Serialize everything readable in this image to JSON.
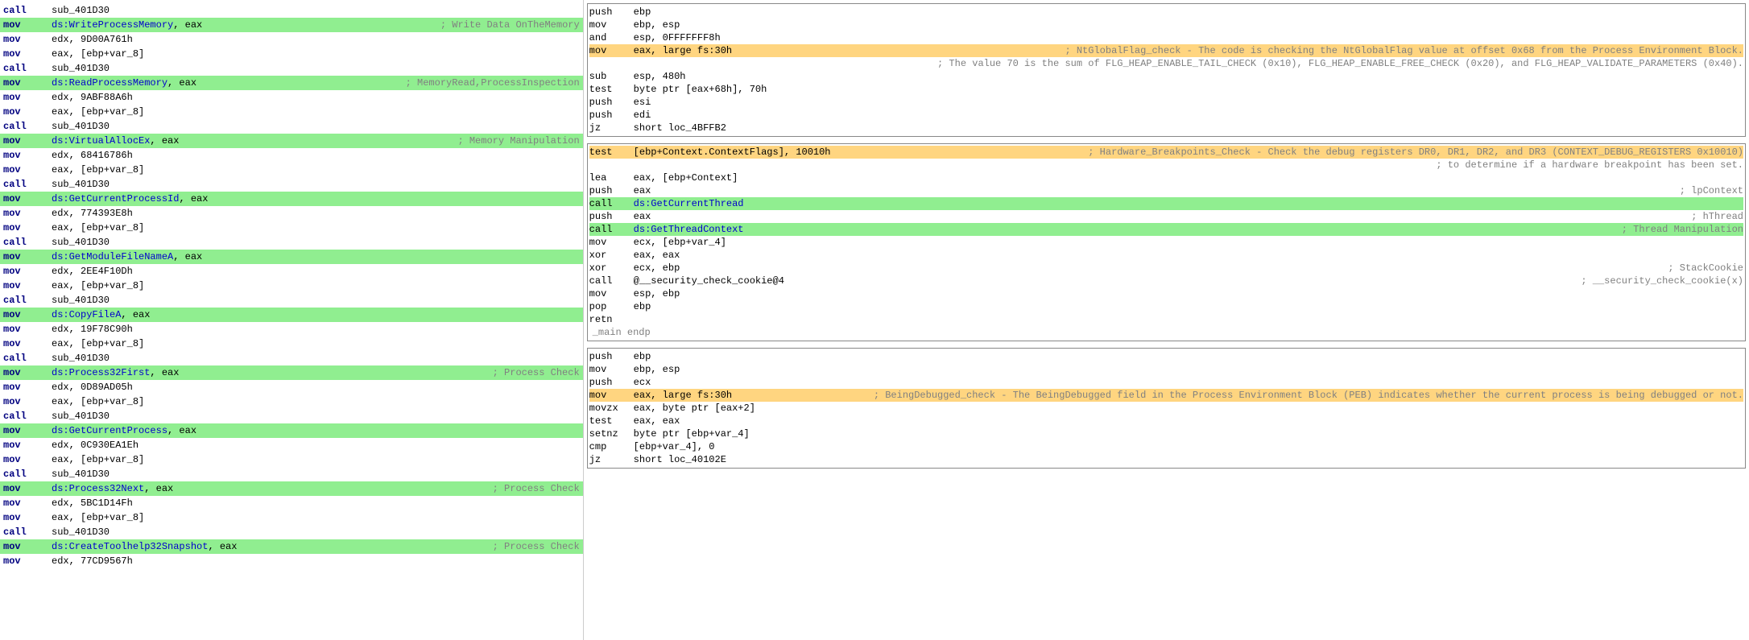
{
  "left_panel": {
    "lines": [
      {
        "type": "normal",
        "mnemonic": "call",
        "operand": "sub_401D30",
        "comment": ""
      },
      {
        "type": "green",
        "mnemonic": "mov",
        "operand": "ds:WriteProcessMemory, eax",
        "comment": "; Write Data OnTheMemory"
      },
      {
        "type": "normal",
        "mnemonic": "mov",
        "operand": "edx, 9D00A761h",
        "comment": ""
      },
      {
        "type": "normal",
        "mnemonic": "mov",
        "operand": "eax, [ebp+var_8]",
        "comment": ""
      },
      {
        "type": "normal",
        "mnemonic": "call",
        "operand": "sub_401D30",
        "comment": ""
      },
      {
        "type": "green",
        "mnemonic": "mov",
        "operand": "ds:ReadProcessMemory, eax",
        "comment": "; MemoryRead,ProcessInspection"
      },
      {
        "type": "normal",
        "mnemonic": "mov",
        "operand": "edx, 9ABF88A6h",
        "comment": ""
      },
      {
        "type": "normal",
        "mnemonic": "mov",
        "operand": "eax, [ebp+var_8]",
        "comment": ""
      },
      {
        "type": "normal",
        "mnemonic": "call",
        "operand": "sub_401D30",
        "comment": ""
      },
      {
        "type": "green",
        "mnemonic": "mov",
        "operand": "ds:VirtualAllocEx, eax",
        "comment": "; Memory Manipulation"
      },
      {
        "type": "normal",
        "mnemonic": "mov",
        "operand": "edx, 68416786h",
        "comment": ""
      },
      {
        "type": "normal",
        "mnemonic": "mov",
        "operand": "eax, [ebp+var_8]",
        "comment": ""
      },
      {
        "type": "normal",
        "mnemonic": "call",
        "operand": "sub_401D30",
        "comment": ""
      },
      {
        "type": "green",
        "mnemonic": "mov",
        "operand": "ds:GetCurrentProcessId, eax",
        "comment": ""
      },
      {
        "type": "normal",
        "mnemonic": "mov",
        "operand": "edx, 774393E8h",
        "comment": ""
      },
      {
        "type": "normal",
        "mnemonic": "mov",
        "operand": "eax, [ebp+var_8]",
        "comment": ""
      },
      {
        "type": "normal",
        "mnemonic": "call",
        "operand": "sub_401D30",
        "comment": ""
      },
      {
        "type": "green",
        "mnemonic": "mov",
        "operand": "ds:GetModuleFileNameA, eax",
        "comment": ""
      },
      {
        "type": "normal",
        "mnemonic": "mov",
        "operand": "edx, 2EE4F10Dh",
        "comment": ""
      },
      {
        "type": "normal",
        "mnemonic": "mov",
        "operand": "eax, [ebp+var_8]",
        "comment": ""
      },
      {
        "type": "normal",
        "mnemonic": "call",
        "operand": "sub_401D30",
        "comment": ""
      },
      {
        "type": "green",
        "mnemonic": "mov",
        "operand": "ds:CopyFileA, eax",
        "comment": ""
      },
      {
        "type": "normal",
        "mnemonic": "mov",
        "operand": "edx, 19F78C90h",
        "comment": ""
      },
      {
        "type": "normal",
        "mnemonic": "mov",
        "operand": "eax, [ebp+var_8]",
        "comment": ""
      },
      {
        "type": "normal",
        "mnemonic": "call",
        "operand": "sub_401D30",
        "comment": ""
      },
      {
        "type": "green",
        "mnemonic": "mov",
        "operand": "ds:Process32First, eax",
        "comment": "; Process Check"
      },
      {
        "type": "normal",
        "mnemonic": "mov",
        "operand": "edx, 0D89AD05h",
        "comment": ""
      },
      {
        "type": "normal",
        "mnemonic": "mov",
        "operand": "eax, [ebp+var_8]",
        "comment": ""
      },
      {
        "type": "normal",
        "mnemonic": "call",
        "operand": "sub_401D30",
        "comment": ""
      },
      {
        "type": "green",
        "mnemonic": "mov",
        "operand": "ds:GetCurrentProcess, eax",
        "comment": ""
      },
      {
        "type": "normal",
        "mnemonic": "mov",
        "operand": "edx, 0C930EA1Eh",
        "comment": ""
      },
      {
        "type": "normal",
        "mnemonic": "mov",
        "operand": "eax, [ebp+var_8]",
        "comment": ""
      },
      {
        "type": "normal",
        "mnemonic": "call",
        "operand": "sub_401D30",
        "comment": ""
      },
      {
        "type": "green",
        "mnemonic": "mov",
        "operand": "ds:Process32Next, eax",
        "comment": "; Process Check"
      },
      {
        "type": "normal",
        "mnemonic": "mov",
        "operand": "edx, 5BC1D14Fh",
        "comment": ""
      },
      {
        "type": "normal",
        "mnemonic": "mov",
        "operand": "eax, [ebp+var_8]",
        "comment": ""
      },
      {
        "type": "normal",
        "mnemonic": "call",
        "operand": "sub_401D30",
        "comment": ""
      },
      {
        "type": "green",
        "mnemonic": "mov",
        "operand": "ds:CreateToolhelp32Snapshot, eax",
        "comment": "; Process Check"
      },
      {
        "type": "normal",
        "mnemonic": "mov",
        "operand": "edx, 77CD9567h",
        "comment": ""
      }
    ]
  },
  "top_right": {
    "lines": [
      {
        "type": "normal",
        "mnemonic": "push",
        "operand": "ebp",
        "comment": ""
      },
      {
        "type": "normal",
        "mnemonic": "mov",
        "operand": "ebp, esp",
        "comment": ""
      },
      {
        "type": "normal",
        "mnemonic": "and",
        "operand": "esp, 0FFFFFFF8h",
        "comment": ""
      },
      {
        "type": "orange",
        "mnemonic": "mov",
        "operand": "eax, large fs:30h",
        "comment": "; NtGlobalFlag_check - The code is checking the NtGlobalFlag value at offset 0x68 from the Process Environment Block."
      },
      {
        "type": "normal",
        "mnemonic": "",
        "operand": "",
        "comment": "; The value 70 is the sum of FLG_HEAP_ENABLE_TAIL_CHECK (0x10), FLG_HEAP_ENABLE_FREE_CHECK (0x20), and FLG_HEAP_VALIDATE_PARAMETERS (0x40)."
      },
      {
        "type": "normal",
        "mnemonic": "sub",
        "operand": "esp, 480h",
        "comment": ""
      },
      {
        "type": "normal",
        "mnemonic": "test",
        "operand": "byte ptr [eax+68h], 70h",
        "comment": ""
      },
      {
        "type": "normal",
        "mnemonic": "push",
        "operand": "esi",
        "comment": ""
      },
      {
        "type": "normal",
        "mnemonic": "push",
        "operand": "edi",
        "comment": ""
      },
      {
        "type": "normal",
        "mnemonic": "jz",
        "operand": "short loc_4BFFB2",
        "comment": ""
      }
    ]
  },
  "mid_right": {
    "lines": [
      {
        "type": "orange",
        "mnemonic": "test",
        "operand": "[ebp+Context.ContextFlags], 10010h",
        "comment": "; Hardware_Breakpoints_Check - Check the debug registers DR0, DR1, DR2, and DR3 (CONTEXT_DEBUG_REGISTERS 0x10010)"
      },
      {
        "type": "normal",
        "mnemonic": "",
        "operand": "",
        "comment": "; to determine if a hardware breakpoint has been set."
      },
      {
        "type": "normal",
        "mnemonic": "lea",
        "operand": "eax, [ebp+Context]",
        "comment": ""
      },
      {
        "type": "normal",
        "mnemonic": "push",
        "operand": "eax",
        "comment": "; lpContext"
      },
      {
        "type": "green",
        "mnemonic": "call",
        "operand": "ds:GetCurrentThread",
        "comment": ""
      },
      {
        "type": "normal",
        "mnemonic": "push",
        "operand": "eax",
        "comment": "; hThread"
      },
      {
        "type": "green",
        "mnemonic": "call",
        "operand": "ds:GetThreadContext",
        "comment": "; Thread Manipulation"
      },
      {
        "type": "normal",
        "mnemonic": "mov",
        "operand": "ecx, [ebp+var_4]",
        "comment": ""
      },
      {
        "type": "normal",
        "mnemonic": "xor",
        "operand": "eax, eax",
        "comment": ""
      },
      {
        "type": "normal",
        "mnemonic": "xor",
        "operand": "ecx, ebp",
        "comment": "; StackCookie"
      },
      {
        "type": "normal",
        "mnemonic": "call",
        "operand": "@__security_check_cookie@4",
        "comment": "; __security_check_cookie(x)"
      },
      {
        "type": "normal",
        "mnemonic": "mov",
        "operand": "esp, ebp",
        "comment": ""
      },
      {
        "type": "normal",
        "mnemonic": "pop",
        "operand": "ebp",
        "comment": ""
      },
      {
        "type": "normal",
        "mnemonic": "retn",
        "operand": "",
        "comment": ""
      },
      {
        "type": "endp",
        "mnemonic": "_main endp",
        "operand": "",
        "comment": ""
      }
    ]
  },
  "bot_right": {
    "lines": [
      {
        "type": "normal",
        "mnemonic": "push",
        "operand": "ebp",
        "comment": ""
      },
      {
        "type": "normal",
        "mnemonic": "mov",
        "operand": "ebp, esp",
        "comment": ""
      },
      {
        "type": "normal",
        "mnemonic": "push",
        "operand": "ecx",
        "comment": ""
      },
      {
        "type": "orange",
        "mnemonic": "mov",
        "operand": "eax, large fs:30h",
        "comment": "; BeingDebugged_check - The BeingDebugged field in the Process Environment Block (PEB) indicates whether the current process is being debugged or not."
      },
      {
        "type": "normal",
        "mnemonic": "movzx",
        "operand": "eax, byte ptr [eax+2]",
        "comment": ""
      },
      {
        "type": "normal",
        "mnemonic": "test",
        "operand": "eax, eax",
        "comment": ""
      },
      {
        "type": "normal",
        "mnemonic": "setnz",
        "operand": "byte ptr [ebp+var_4]",
        "comment": ""
      },
      {
        "type": "normal",
        "mnemonic": "cmp",
        "operand": "[ebp+var_4], 0",
        "comment": ""
      },
      {
        "type": "normal",
        "mnemonic": "jz",
        "operand": "short loc_40102E",
        "comment": ""
      }
    ]
  }
}
